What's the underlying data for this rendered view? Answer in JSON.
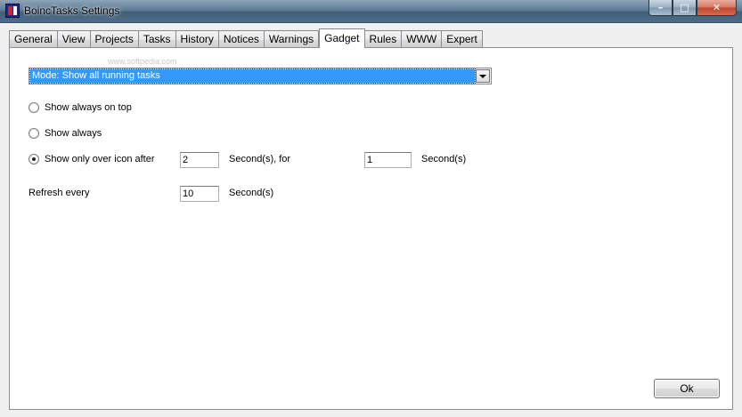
{
  "window": {
    "title": "BoincTasks Settings"
  },
  "titlebar_buttons": {
    "minimize": "–",
    "maximize": "□",
    "close": "✕"
  },
  "tabs": [
    {
      "label": "General"
    },
    {
      "label": "View"
    },
    {
      "label": "Projects"
    },
    {
      "label": "Tasks"
    },
    {
      "label": "History"
    },
    {
      "label": "Notices"
    },
    {
      "label": "Warnings"
    },
    {
      "label": "Gadget",
      "active": true
    },
    {
      "label": "Rules"
    },
    {
      "label": "WWW"
    },
    {
      "label": "Expert"
    }
  ],
  "gadget": {
    "watermark": "www.softpedia.com",
    "mode": {
      "selected": "Mode: Show all running tasks"
    },
    "options": [
      {
        "label": "Show always on top",
        "checked": false
      },
      {
        "label": "Show always",
        "checked": false
      },
      {
        "label": "Show only over icon after",
        "checked": true
      }
    ],
    "icon_delay": {
      "value": "2",
      "unit_label": "Second(s), for"
    },
    "duration": {
      "value": "1",
      "unit_label": "Second(s)"
    },
    "refresh": {
      "label": "Refresh every",
      "value": "10",
      "unit_label": "Second(s)"
    }
  },
  "footer": {
    "ok_label": "Ok"
  }
}
